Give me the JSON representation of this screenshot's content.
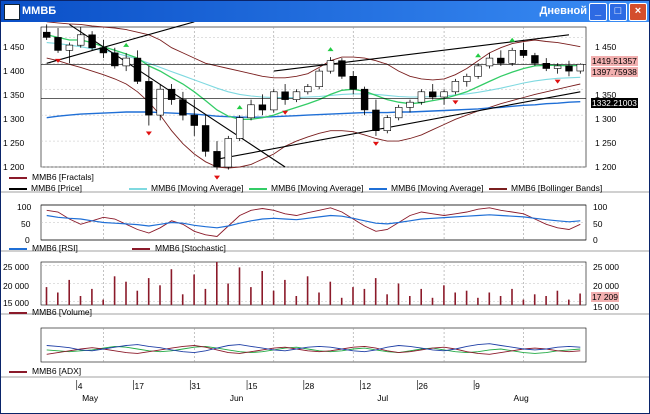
{
  "window": {
    "title": "ММВБ",
    "mode": "Дневной",
    "min_label": "_",
    "max_label": "□",
    "close_label": "×"
  },
  "colors": {
    "titlebar": "#0a4fc7",
    "up": "#000000",
    "down": "#000000",
    "ma_fast": "#33cc66",
    "ma_mid": "#7fd9e0",
    "ma_slow": "#1f6fd6",
    "bollinger": "#7a1f1f",
    "volume": "#8b1a2a",
    "rsi": "#1f6fd6",
    "stoch": "#8b1a2a"
  },
  "price_axis": {
    "ticks": [
      "1 450",
      "1 400",
      "1 350",
      "1 300",
      "1 250",
      "1 200"
    ]
  },
  "price_tags": {
    "upper": "1419.51357",
    "mid": "1397.75938",
    "lower": "1332.21003"
  },
  "legend_price": [
    {
      "label": "MMB6 [Fractals]",
      "color": "#8b1a2a"
    },
    {
      "label": "MMB6 [Price]",
      "color": "#000000"
    },
    {
      "label": "MMB6 [Moving Average]",
      "color": "#7fd9e0"
    },
    {
      "label": "MMB6 [Moving Average]",
      "color": "#33cc66"
    },
    {
      "label": "MMB6 [Moving Average]",
      "color": "#1f6fd6"
    },
    {
      "label": "MMB6 [Bollinger Bands]",
      "color": "#7a1f1f"
    }
  ],
  "osc_axis": {
    "ticks": [
      "100",
      "50",
      "0"
    ]
  },
  "legend_osc": [
    {
      "label": "MMB6 [RSI]",
      "color": "#1f6fd6"
    },
    {
      "label": "MMB6 [Stochastic]",
      "color": "#8b1a2a"
    }
  ],
  "volume_axis": {
    "ticks": [
      "25 000",
      "20 000",
      "15 000"
    ],
    "last_tag": "17 209"
  },
  "legend_volume": [
    {
      "label": "MMB6 [Volume]",
      "color": "#8b1a2a"
    }
  ],
  "legend_adx": [
    {
      "label": "MMB6 [ADX]",
      "color": "#8b1a2a"
    }
  ],
  "date_axis": {
    "days": [
      "4",
      "17",
      "31",
      "15",
      "28",
      "12",
      "26",
      "9"
    ],
    "months": [
      "May",
      "Jun",
      "Jul",
      "Aug"
    ]
  },
  "chart_data": {
    "type": "candlestick",
    "price": {
      "ylim": [
        1200,
        1470
      ],
      "candles": [
        [
          1460,
          1475,
          1445,
          1450
        ],
        [
          1450,
          1468,
          1420,
          1425
        ],
        [
          1425,
          1440,
          1400,
          1435
        ],
        [
          1435,
          1470,
          1430,
          1455
        ],
        [
          1455,
          1462,
          1425,
          1430
        ],
        [
          1430,
          1445,
          1410,
          1420
        ],
        [
          1420,
          1430,
          1390,
          1395
        ],
        [
          1395,
          1420,
          1385,
          1410
        ],
        [
          1410,
          1425,
          1360,
          1365
        ],
        [
          1365,
          1395,
          1280,
          1300
        ],
        [
          1300,
          1360,
          1290,
          1350
        ],
        [
          1350,
          1360,
          1320,
          1330
        ],
        [
          1330,
          1345,
          1290,
          1300
        ],
        [
          1300,
          1330,
          1260,
          1280
        ],
        [
          1280,
          1300,
          1220,
          1230
        ],
        [
          1230,
          1250,
          1195,
          1200
        ],
        [
          1200,
          1260,
          1195,
          1255
        ],
        [
          1255,
          1300,
          1250,
          1295
        ],
        [
          1295,
          1330,
          1290,
          1320
        ],
        [
          1320,
          1340,
          1300,
          1310
        ],
        [
          1310,
          1350,
          1305,
          1345
        ],
        [
          1345,
          1360,
          1320,
          1330
        ],
        [
          1330,
          1350,
          1325,
          1345
        ],
        [
          1345,
          1360,
          1340,
          1355
        ],
        [
          1355,
          1390,
          1350,
          1385
        ],
        [
          1385,
          1412,
          1380,
          1405
        ],
        [
          1405,
          1410,
          1370,
          1375
        ],
        [
          1375,
          1385,
          1340,
          1350
        ],
        [
          1350,
          1355,
          1300,
          1310
        ],
        [
          1310,
          1330,
          1260,
          1270
        ],
        [
          1270,
          1300,
          1265,
          1295
        ],
        [
          1295,
          1320,
          1290,
          1315
        ],
        [
          1315,
          1330,
          1305,
          1325
        ],
        [
          1325,
          1350,
          1320,
          1345
        ],
        [
          1345,
          1360,
          1330,
          1335
        ],
        [
          1335,
          1350,
          1320,
          1345
        ],
        [
          1345,
          1370,
          1340,
          1365
        ],
        [
          1365,
          1380,
          1355,
          1375
        ],
        [
          1375,
          1400,
          1370,
          1395
        ],
        [
          1395,
          1420,
          1390,
          1410
        ],
        [
          1410,
          1425,
          1395,
          1400
        ],
        [
          1400,
          1430,
          1395,
          1425
        ],
        [
          1425,
          1440,
          1410,
          1415
        ],
        [
          1415,
          1420,
          1395,
          1400
        ],
        [
          1400,
          1410,
          1385,
          1390
        ],
        [
          1390,
          1400,
          1380,
          1395
        ],
        [
          1395,
          1405,
          1375,
          1385
        ],
        [
          1385,
          1400,
          1380,
          1398
        ]
      ],
      "ma_fast": [
        1455,
        1450,
        1445,
        1445,
        1440,
        1432,
        1425,
        1418,
        1410,
        1395,
        1385,
        1372,
        1360,
        1345,
        1328,
        1310,
        1298,
        1292,
        1292,
        1295,
        1300,
        1308,
        1315,
        1322,
        1330,
        1340,
        1348,
        1350,
        1346,
        1338,
        1330,
        1325,
        1322,
        1324,
        1328,
        1332,
        1338,
        1345,
        1355,
        1365,
        1375,
        1383,
        1390,
        1395,
        1396,
        1396,
        1395,
        1396
      ],
      "ma_mid": [
        1440,
        1438,
        1435,
        1432,
        1428,
        1425,
        1420,
        1414,
        1408,
        1400,
        1392,
        1384,
        1376,
        1368,
        1360,
        1352,
        1345,
        1340,
        1337,
        1335,
        1334,
        1334,
        1334,
        1335,
        1336,
        1338,
        1340,
        1341,
        1341,
        1340,
        1338,
        1336,
        1335,
        1335,
        1336,
        1337,
        1339,
        1341,
        1344,
        1348,
        1352,
        1357,
        1362,
        1366,
        1369,
        1371,
        1372,
        1373
      ],
      "ma_slow": [
        1295,
        1298,
        1300,
        1302,
        1303,
        1304,
        1305,
        1306,
        1306,
        1306,
        1305,
        1304,
        1303,
        1302,
        1300,
        1298,
        1297,
        1296,
        1296,
        1296,
        1297,
        1298,
        1299,
        1300,
        1301,
        1302,
        1303,
        1304,
        1305,
        1305,
        1305,
        1306,
        1306,
        1307,
        1308,
        1309,
        1310,
        1311,
        1312,
        1314,
        1315,
        1317,
        1319,
        1320,
        1322,
        1323,
        1325,
        1326
      ],
      "boll_upper": [
        1480,
        1478,
        1476,
        1475,
        1472,
        1470,
        1468,
        1465,
        1460,
        1455,
        1445,
        1430,
        1420,
        1410,
        1400,
        1395,
        1390,
        1385,
        1380,
        1375,
        1372,
        1372,
        1375,
        1380,
        1392,
        1405,
        1412,
        1412,
        1410,
        1405,
        1398,
        1385,
        1375,
        1370,
        1368,
        1370,
        1378,
        1390,
        1405,
        1420,
        1430,
        1438,
        1442,
        1445,
        1442,
        1440,
        1436,
        1432
      ],
      "boll_lower": [
        1410,
        1405,
        1398,
        1392,
        1385,
        1378,
        1370,
        1360,
        1345,
        1325,
        1300,
        1270,
        1245,
        1225,
        1210,
        1200,
        1198,
        1200,
        1205,
        1215,
        1225,
        1240,
        1250,
        1258,
        1265,
        1270,
        1270,
        1268,
        1262,
        1255,
        1250,
        1250,
        1255,
        1262,
        1272,
        1282,
        1292,
        1300,
        1308,
        1315,
        1322,
        1328,
        1334,
        1340,
        1345,
        1350,
        1355,
        1360
      ],
      "fractals_up": [
        3,
        7,
        17,
        25,
        38,
        41
      ],
      "fractals_down": [
        1,
        9,
        15,
        21,
        29,
        36,
        45
      ]
    },
    "oscillator": {
      "ylim": [
        0,
        100
      ],
      "rsi": [
        70,
        65,
        62,
        60,
        55,
        50,
        48,
        46,
        44,
        40,
        45,
        50,
        48,
        42,
        38,
        35,
        40,
        48,
        55,
        60,
        62,
        60,
        58,
        62,
        66,
        70,
        68,
        62,
        55,
        48,
        46,
        50,
        55,
        60,
        62,
        64,
        66,
        68,
        70,
        72,
        70,
        68,
        66,
        62,
        58,
        55,
        52,
        55
      ],
      "stochastic": [
        85,
        80,
        60,
        45,
        55,
        65,
        60,
        45,
        30,
        20,
        35,
        55,
        45,
        25,
        15,
        10,
        40,
        70,
        85,
        90,
        85,
        75,
        70,
        78,
        85,
        92,
        80,
        60,
        40,
        25,
        30,
        50,
        70,
        80,
        75,
        70,
        75,
        80,
        88,
        92,
        85,
        80,
        75,
        60,
        45,
        35,
        30,
        45
      ]
    },
    "volume": {
      "ylim": [
        14000,
        26000
      ],
      "values": [
        19000,
        17500,
        21000,
        16500,
        18500,
        15500,
        22000,
        20500,
        18000,
        21500,
        19500,
        24000,
        17000,
        22500,
        18500,
        26000,
        20000,
        24500,
        19000,
        23500,
        18000,
        21000,
        16500,
        22000,
        17500,
        20500,
        16000,
        19000,
        18500,
        21500,
        17000,
        20000,
        16500,
        18500,
        16000,
        19500,
        17500,
        18000,
        16000,
        17500,
        16500,
        18500,
        15500,
        17000,
        16500,
        18000,
        15500,
        17209
      ]
    },
    "adx": {
      "line1": [
        60,
        58,
        55,
        50,
        48,
        52,
        56,
        60,
        62,
        58,
        55,
        50,
        46,
        44,
        48,
        54,
        60,
        62,
        58,
        54,
        50,
        48,
        52,
        56,
        58,
        56,
        52,
        48,
        46,
        50,
        56,
        60,
        58,
        54,
        50,
        48,
        52,
        58,
        62,
        64,
        60,
        56,
        52,
        50,
        52,
        56,
        58,
        56
      ],
      "line2": [
        40,
        44,
        48,
        52,
        55,
        52,
        48,
        44,
        42,
        46,
        50,
        54,
        58,
        60,
        56,
        50,
        44,
        42,
        46,
        50,
        54,
        56,
        52,
        48,
        46,
        48,
        52,
        56,
        58,
        54,
        48,
        44,
        46,
        50,
        54,
        56,
        52,
        46,
        42,
        40,
        44,
        48,
        52,
        54,
        52,
        48,
        46,
        48
      ],
      "line3": [
        50,
        48,
        46,
        48,
        50,
        54,
        58,
        56,
        52,
        48,
        46,
        48,
        52,
        56,
        58,
        54,
        50,
        46,
        44,
        46,
        50,
        54,
        56,
        52,
        48,
        46,
        48,
        52,
        54,
        50,
        46,
        44,
        48,
        52,
        54,
        50,
        46,
        44,
        46,
        50,
        52,
        48,
        44,
        42,
        44,
        48,
        50,
        52
      ]
    }
  }
}
